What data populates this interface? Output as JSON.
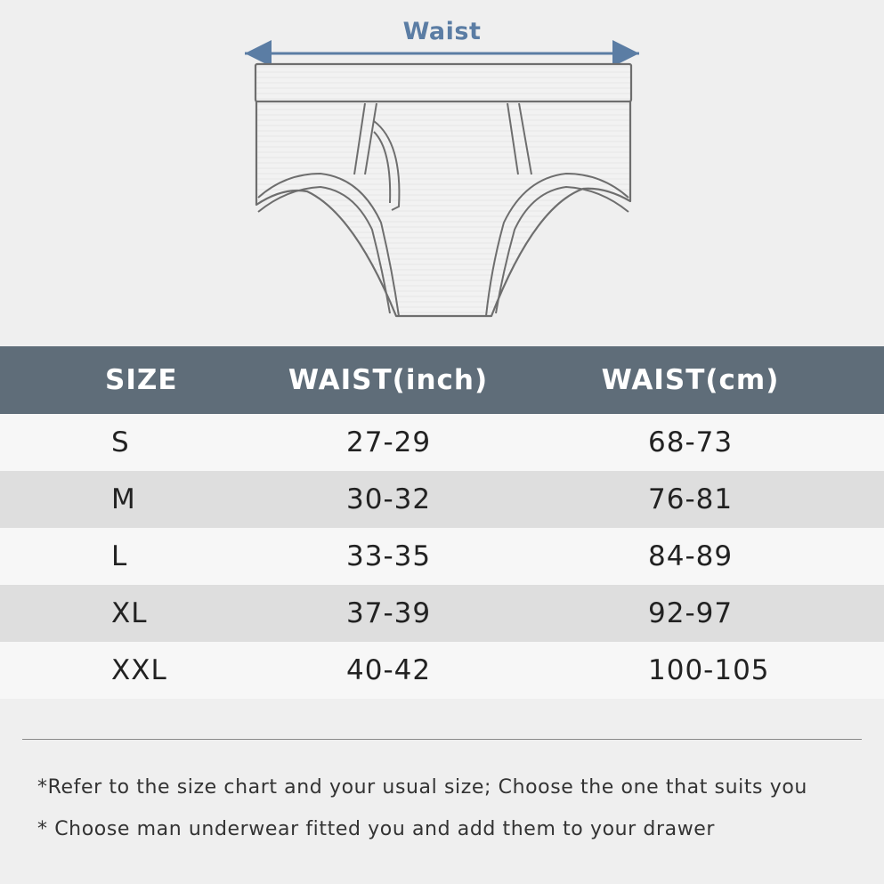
{
  "illustration": {
    "waist_label": "Waist",
    "accent_color": "#5b7da4",
    "icon": "briefs-icon"
  },
  "table": {
    "header_color": "#5f6d79",
    "headers": [
      "SIZE",
      "WAIST(inch)",
      "WAIST(cm)"
    ],
    "rows": [
      {
        "size": "S",
        "inch": "27-29",
        "cm": "68-73"
      },
      {
        "size": "M",
        "inch": "30-32",
        "cm": "76-81"
      },
      {
        "size": "L",
        "inch": "33-35",
        "cm": "84-89"
      },
      {
        "size": "XL",
        "inch": "37-39",
        "cm": "92-97"
      },
      {
        "size": "XXL",
        "inch": "40-42",
        "cm": "100-105"
      }
    ]
  },
  "notes": [
    "*Refer to the size chart and your usual size; Choose the one that suits you",
    "* Choose man underwear fitted you and add them to your drawer"
  ]
}
